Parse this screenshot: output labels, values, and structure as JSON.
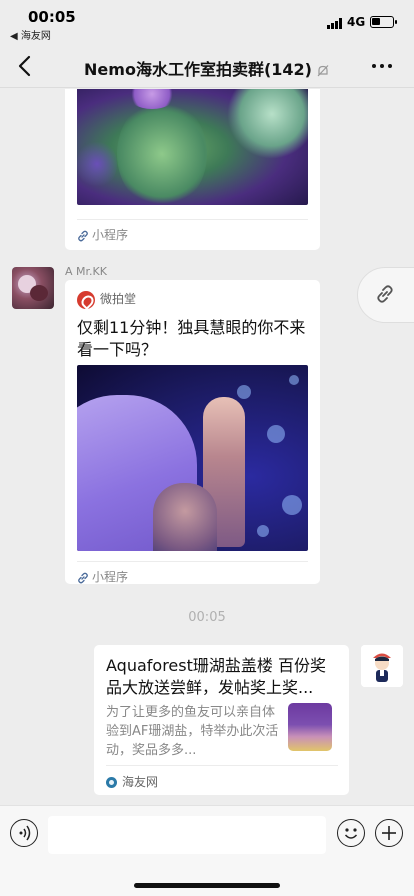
{
  "status_bar": {
    "time": "00:05",
    "back_app": "◀ 海友网",
    "network": "4G"
  },
  "nav": {
    "title": "Nemo海水工作室拍卖群(142)",
    "back_icon": "chevron-left-icon",
    "more_icon": "more-dots-icon",
    "mute_icon": "bell-muted-icon"
  },
  "messages": [
    {
      "type": "mini-program",
      "source_label": "小程序"
    },
    {
      "type": "mini-program",
      "sender": "A   Mr.KK",
      "source_name": "微拍堂",
      "text": "仅剩11分钟！独具慧眼的你不来看一下吗？",
      "source_label": "小程序"
    }
  ],
  "timestamp": "00:05",
  "share_card": {
    "title": "Aquaforest珊湖盐盖楼 百份奖品大放送尝鲜，发帖奖上奖...",
    "description": "为了让更多的鱼友可以亲自体验到AF珊湖盐，特举办此次活动，奖品多多...",
    "source_name": "海友网"
  },
  "input_bar": {
    "voice_icon": "voice-icon",
    "emoji_icon": "emoji-icon",
    "plus_icon": "plus-icon"
  }
}
